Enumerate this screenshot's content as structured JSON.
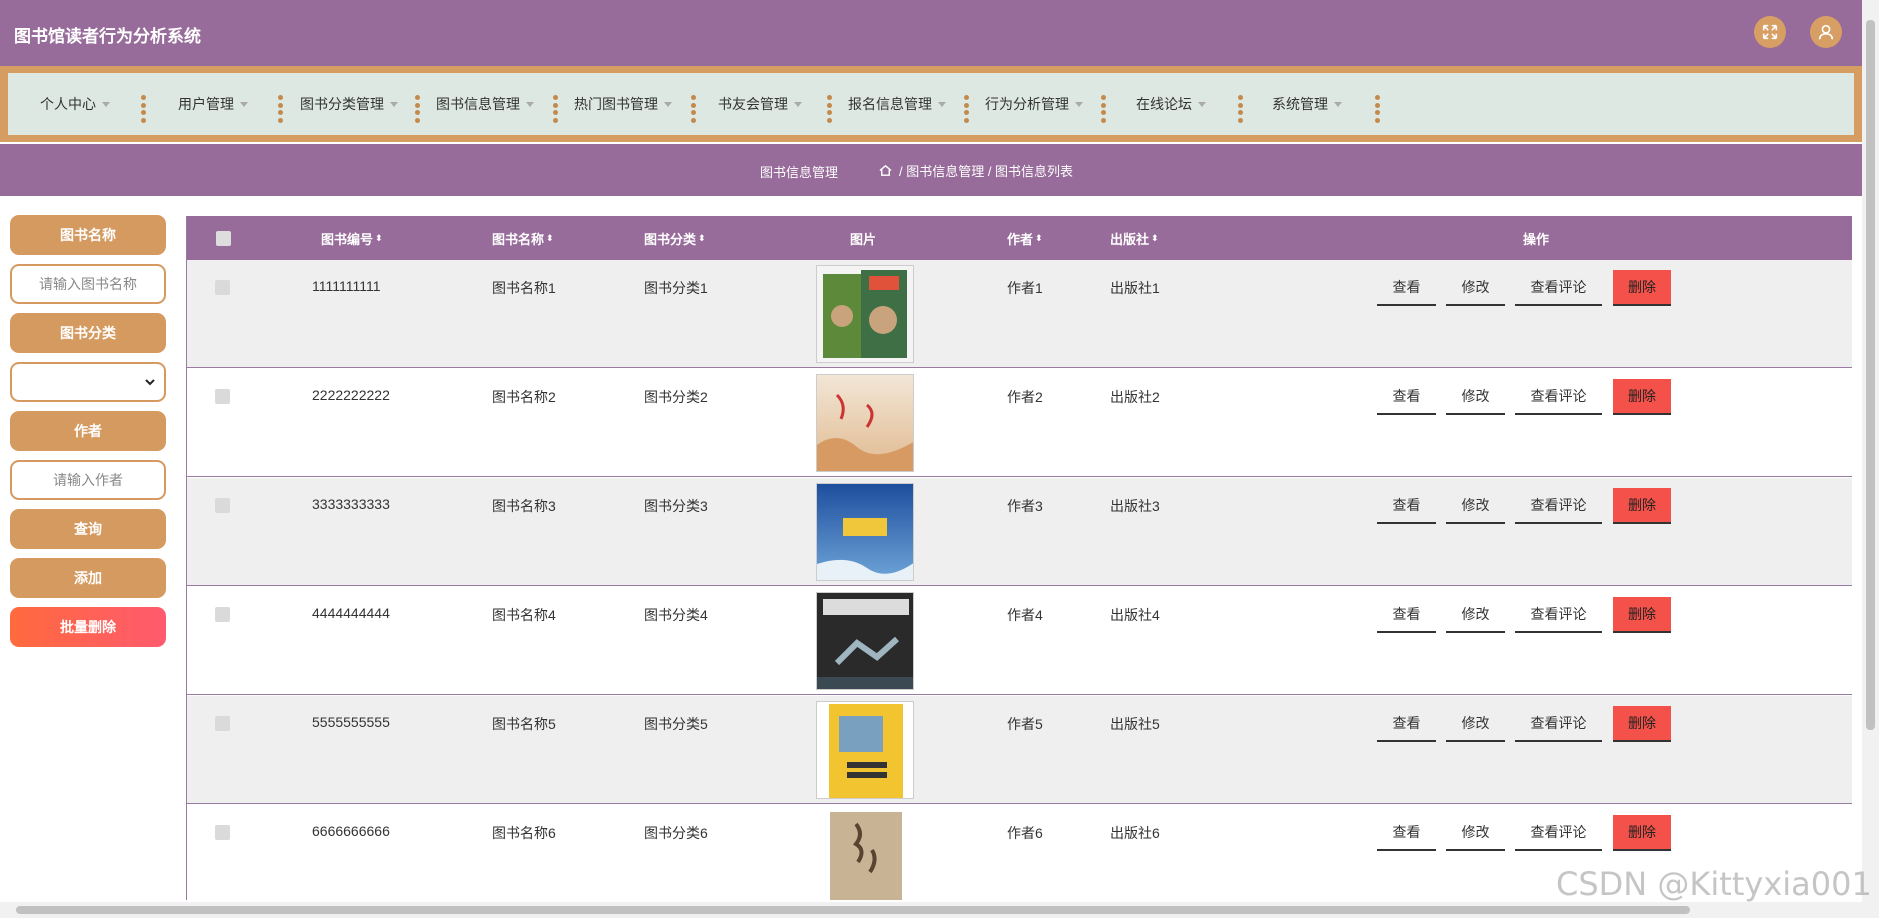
{
  "app": {
    "title": "图书馆读者行为分析系统"
  },
  "nav": {
    "items": [
      "个人中心",
      "用户管理",
      "图书分类管理",
      "图书信息管理",
      "热门图书管理",
      "书友会管理",
      "报名信息管理",
      "行为分析管理",
      "在线论坛",
      "系统管理"
    ]
  },
  "breadcrumb": {
    "section": "图书信息管理",
    "path": "/ 图书信息管理 / 图书信息列表"
  },
  "sidebar": {
    "name_label": "图书名称",
    "name_placeholder": "请输入图书名称",
    "category_label": "图书分类",
    "author_label": "作者",
    "author_placeholder": "请输入作者",
    "query_button": "查询",
    "add_button": "添加",
    "batch_delete_button": "批量删除"
  },
  "table": {
    "columns": {
      "book_no": "图书编号",
      "book_name": "图书名称",
      "category": "图书分类",
      "image": "图片",
      "author": "作者",
      "publisher": "出版社",
      "actions": "操作"
    },
    "actions": {
      "view": "查看",
      "edit": "修改",
      "comments": "查看评论",
      "delete": "删除"
    },
    "rows": [
      {
        "book_no": "1111111111",
        "book_name": "图书名称1",
        "category": "图书分类1",
        "author": "作者1",
        "publisher": "出版社1"
      },
      {
        "book_no": "2222222222",
        "book_name": "图书名称2",
        "category": "图书分类2",
        "author": "作者2",
        "publisher": "出版社2"
      },
      {
        "book_no": "3333333333",
        "book_name": "图书名称3",
        "category": "图书分类3",
        "author": "作者3",
        "publisher": "出版社3"
      },
      {
        "book_no": "4444444444",
        "book_name": "图书名称4",
        "category": "图书分类4",
        "author": "作者4",
        "publisher": "出版社4"
      },
      {
        "book_no": "5555555555",
        "book_name": "图书名称5",
        "category": "图书分类5",
        "author": "作者5",
        "publisher": "出版社5"
      },
      {
        "book_no": "6666666666",
        "book_name": "图书名称6",
        "category": "图书分类6",
        "author": "作者6",
        "publisher": "出版社6"
      }
    ]
  },
  "watermark": "CSDN @Kittyxia001",
  "colors": {
    "header_purple": "#976b9a",
    "accent_orange": "#d49a5f",
    "nav_bg": "#dde8e2",
    "delete_red": "#f3514a"
  }
}
